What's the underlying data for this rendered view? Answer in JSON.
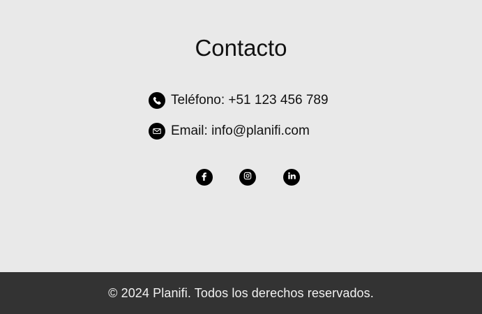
{
  "contact": {
    "title": "Contacto",
    "phone": {
      "icon": "phone-icon",
      "text": "Teléfono: +51 123 456 789"
    },
    "email": {
      "icon": "envelope-icon",
      "text": "Email: info@planifi.com"
    }
  },
  "social": [
    {
      "name": "Facebook",
      "icon": "facebook-icon"
    },
    {
      "name": "Instagram",
      "icon": "instagram-icon"
    },
    {
      "name": "LinkedIn",
      "icon": "linkedin-icon"
    }
  ],
  "footer": {
    "copyright": "© 2024 Planifi. Todos los derechos reservados."
  },
  "colors": {
    "page_background": "#e9e9e9",
    "footer_background": "#333333",
    "icon": "#000000",
    "footer_text": "#f2f2f2"
  }
}
